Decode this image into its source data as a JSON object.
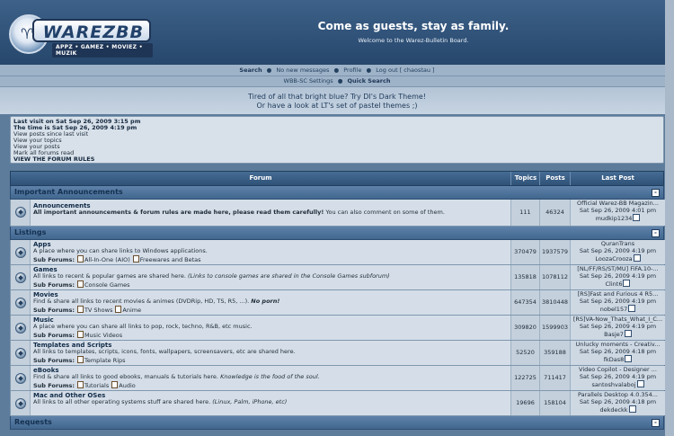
{
  "header": {
    "logo_word": "WAREZBB",
    "logo_tagline": "APPZ • GAMEZ • MOVIEZ • MUZIK",
    "title": "Come as guests, stay as family.",
    "description": "Welcome to the Warez-Bulletin Board."
  },
  "nav": {
    "search": "Search",
    "new_messages": "No new messages",
    "profile": "Profile",
    "logout": "Log out [ chaostau ]",
    "settings": "WBB-SC Settings",
    "quick_search": "Quick Search",
    "sep": "●"
  },
  "promo": {
    "line1": "Tired of all that bright blue? Try DI's Dark Theme!",
    "line2": "Or have a look at LT's set of pastel themes ;)"
  },
  "infobox": {
    "last_visit": "Last visit on Sat Sep 26, 2009 3:15 pm",
    "time_is": "The time is Sat Sep 26, 2009 4:19 pm",
    "since_last": "View posts since last visit",
    "your_topics": "View your topics",
    "your_posts": "View your posts",
    "mark_read": "Mark all forums read",
    "rules": "VIEW THE FORUM RULES"
  },
  "table": {
    "headers": {
      "forum": "Forum",
      "topics": "Topics",
      "posts": "Posts",
      "last_post": "Last Post"
    },
    "toggle_symbol": "-",
    "sub_forums_label": "Sub Forums:",
    "categories": [
      {
        "name": "Important Announcements",
        "forums": [
          {
            "name": "Announcements",
            "desc_bold": "All important announcements & forum rules are made here, please read them carefully!",
            "desc": " You can also comment on some of them.",
            "topics": "111",
            "posts": "46324",
            "last_title": "Official Warez-BB Magazin...",
            "last_date": "Sat Sep 26, 2009 4:01 pm",
            "last_user": "mudkip1234"
          }
        ]
      },
      {
        "name": "Listings",
        "forums": [
          {
            "name": "Apps",
            "desc": "A place where you can share links to Windows applications.",
            "subs": [
              "All-In-One (AIO)",
              "Freewares and Betas"
            ],
            "topics": "370479",
            "posts": "1937579",
            "last_title": "QuranTrans",
            "last_date": "Sat Sep 26, 2009 4:19 pm",
            "last_user": "LoozaCrooza"
          },
          {
            "name": "Games",
            "desc": "All links to recent & popular games are shared here. ",
            "desc_italic": "(Links to console games are shared in the Console Games subforum)",
            "subs": [
              "Console Games"
            ],
            "topics": "135818",
            "posts": "1078112",
            "last_title": "[NL/FF/RS/ST/MU] FiFA.10-...",
            "last_date": "Sat Sep 26, 2009 4:19 pm",
            "last_user": "Clint6"
          },
          {
            "name": "Movies",
            "desc": "Find & share all links to recent movies & animes (DVDRip, HD, TS, R5, ...). ",
            "desc_bi": "No porn!",
            "subs": [
              "TV Shows",
              "Anime"
            ],
            "topics": "647354",
            "posts": "3810448",
            "last_title": "[RS]Fast and Furious 4 R5...",
            "last_date": "Sat Sep 26, 2009 4:19 pm",
            "last_user": "nobel157"
          },
          {
            "name": "Music",
            "desc": "A place where you can share all links to pop, rock, techno, R&B, etc music.",
            "subs": [
              "Music Videos"
            ],
            "topics": "309820",
            "posts": "1599903",
            "last_title": "[RS]VA-Now_Thats_What_I_C...",
            "last_date": "Sat Sep 26, 2009 4:19 pm",
            "last_user": "Basje7"
          },
          {
            "name": "Templates and Scripts",
            "desc": "All links to templates, scripts, icons, fonts, wallpapers, screensavers, etc are shared here.",
            "subs": [
              "Template Rips"
            ],
            "topics": "52520",
            "posts": "359188",
            "last_title": "Unlucky moments - Creativ...",
            "last_date": "Sat Sep 26, 2009 4:18 pm",
            "last_user": "fkDas8"
          },
          {
            "name": "eBooks",
            "desc": "Find & share all links to good ebooks, manuals & tutorials here. ",
            "desc_italic": "Knowledge is the food of the soul.",
            "subs": [
              "Tutorials",
              "Audio"
            ],
            "topics": "122725",
            "posts": "711417",
            "last_title": "Video Copilot - Designer ...",
            "last_date": "Sat Sep 26, 2009 4:19 pm",
            "last_user": "santoshvalaboj"
          },
          {
            "name": "Mac and Other OSes",
            "desc": "All links to all other operating systems stuff are shared here. ",
            "desc_italic": "(Linux, Palm, iPhone, etc)",
            "topics": "19696",
            "posts": "158104",
            "last_title": "Parallels Desktop 4.0.354...",
            "last_date": "Sat Sep 26, 2009 4:18 pm",
            "last_user": "dekdeckk"
          }
        ]
      },
      {
        "name": "Requests",
        "forums": []
      }
    ]
  }
}
